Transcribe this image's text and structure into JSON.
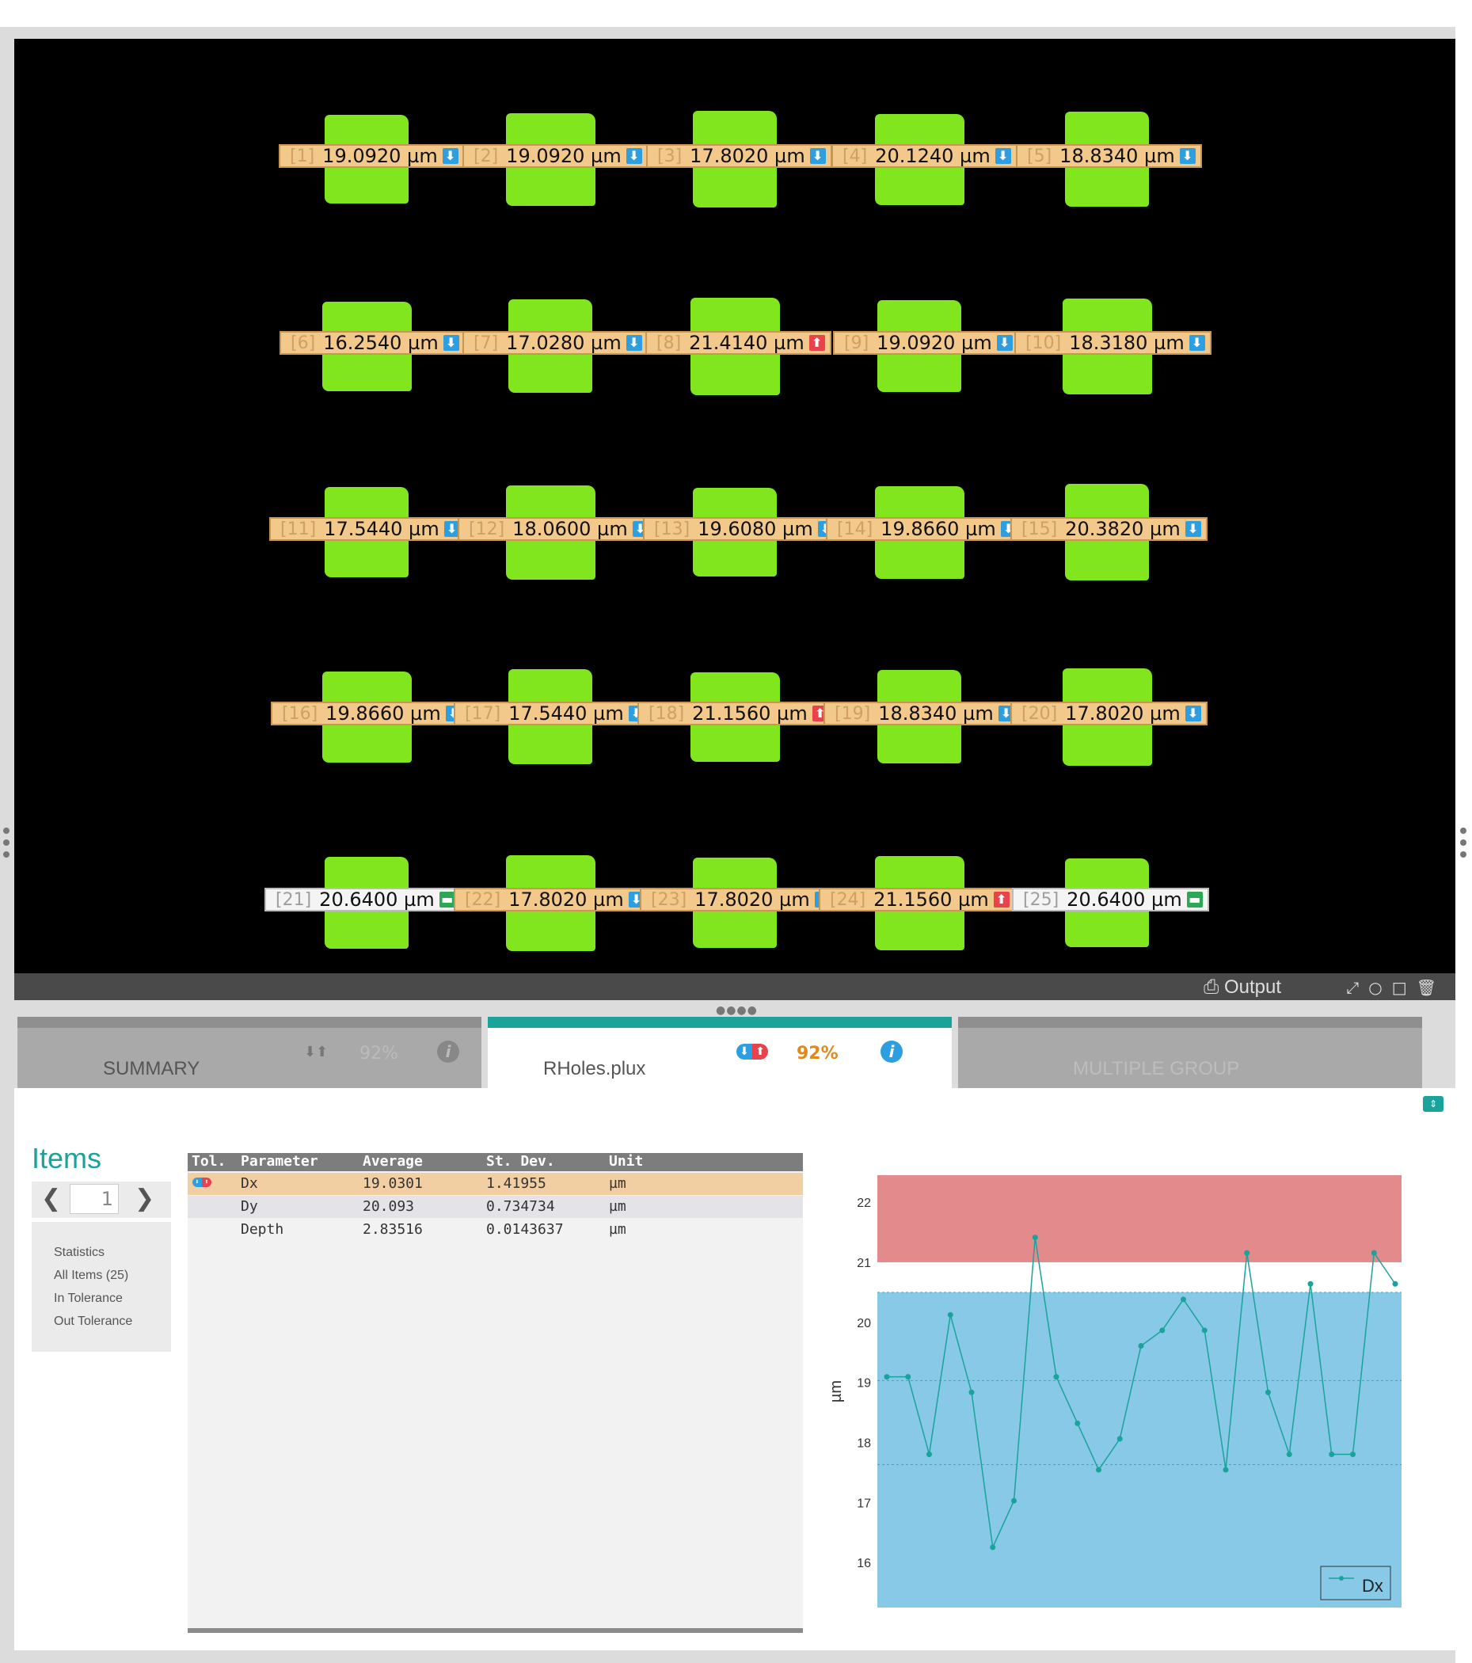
{
  "viewer": {
    "measurements": [
      {
        "idx": "[1]",
        "value": "19.0920 µm",
        "tol": "down"
      },
      {
        "idx": "[2]",
        "value": "19.0920 µm",
        "tol": "down"
      },
      {
        "idx": "[3]",
        "value": "17.8020 µm",
        "tol": "down"
      },
      {
        "idx": "[4]",
        "value": "20.1240 µm",
        "tol": "down"
      },
      {
        "idx": "[5]",
        "value": "18.8340 µm",
        "tol": "down"
      },
      {
        "idx": "[6]",
        "value": "16.2540 µm",
        "tol": "down"
      },
      {
        "idx": "[7]",
        "value": "17.0280 µm",
        "tol": "down"
      },
      {
        "idx": "[8]",
        "value": "21.4140 µm",
        "tol": "up"
      },
      {
        "idx": "[9]",
        "value": "19.0920 µm",
        "tol": "down"
      },
      {
        "idx": "[10]",
        "value": "18.3180 µm",
        "tol": "down"
      },
      {
        "idx": "[11]",
        "value": "17.5440 µm",
        "tol": "down"
      },
      {
        "idx": "[12]",
        "value": "18.0600 µm",
        "tol": "down"
      },
      {
        "idx": "[13]",
        "value": "19.6080 µm",
        "tol": "down"
      },
      {
        "idx": "[14]",
        "value": "19.8660 µm",
        "tol": "down"
      },
      {
        "idx": "[15]",
        "value": "20.3820 µm",
        "tol": "down"
      },
      {
        "idx": "[16]",
        "value": "19.8660 µm",
        "tol": "down"
      },
      {
        "idx": "[17]",
        "value": "17.5440 µm",
        "tol": "down"
      },
      {
        "idx": "[18]",
        "value": "21.1560 µm",
        "tol": "up"
      },
      {
        "idx": "[19]",
        "value": "18.8340 µm",
        "tol": "down"
      },
      {
        "idx": "[20]",
        "value": "17.8020 µm",
        "tol": "down"
      },
      {
        "idx": "[21]",
        "value": "20.6400 µm",
        "tol": "eq"
      },
      {
        "idx": "[22]",
        "value": "17.8020 µm",
        "tol": "down"
      },
      {
        "idx": "[23]",
        "value": "17.8020 µm",
        "tol": "down"
      },
      {
        "idx": "[24]",
        "value": "21.1560 µm",
        "tol": "up"
      },
      {
        "idx": "[25]",
        "value": "20.6400 µm",
        "tol": "eq"
      }
    ],
    "output_label": "Output"
  },
  "tabs": [
    {
      "label": "SUMMARY",
      "percent": "92%"
    },
    {
      "label": "RHoles.plux",
      "percent": "92%"
    },
    {
      "label": "MULTIPLE GROUP"
    }
  ],
  "items": {
    "title": "Items",
    "page": "1",
    "filters": [
      "Statistics",
      "All Items (25)",
      "In Tolerance",
      "Out Tolerance"
    ]
  },
  "table": {
    "headers": [
      "Tol.",
      "Parameter",
      "Average",
      "St. Dev.",
      "Unit"
    ],
    "rows": [
      {
        "param": "Dx",
        "avg": "19.0301",
        "sd": "1.41955",
        "unit": "µm"
      },
      {
        "param": "Dy",
        "avg": "20.093",
        "sd": "0.734734",
        "unit": "µm"
      },
      {
        "param": "Depth",
        "avg": "2.83516",
        "sd": "0.0143637",
        "unit": "µm"
      }
    ]
  },
  "chart_data": {
    "type": "line",
    "ylabel": "µm",
    "ylim": [
      15.25,
      22.45
    ],
    "yticks": [
      16,
      17,
      18,
      19,
      20,
      21,
      22
    ],
    "grid": false,
    "legend": "bottom-right",
    "series": [
      {
        "name": "Dx",
        "color": "#1aa39a",
        "values": [
          19.092,
          19.092,
          17.802,
          20.124,
          18.834,
          16.254,
          17.028,
          21.414,
          19.092,
          18.318,
          17.544,
          18.06,
          19.608,
          19.866,
          20.382,
          19.866,
          17.544,
          21.156,
          18.834,
          17.802,
          20.64,
          17.802,
          17.802,
          21.156,
          20.64
        ]
      }
    ],
    "bands": [
      {
        "from": 21.0,
        "to": 22.45,
        "color": "#e38a8d"
      },
      {
        "from": 15.25,
        "to": 20.5,
        "color": "#87c9e7"
      }
    ],
    "reference_lines": [
      20.5,
      19.03,
      17.63
    ]
  }
}
